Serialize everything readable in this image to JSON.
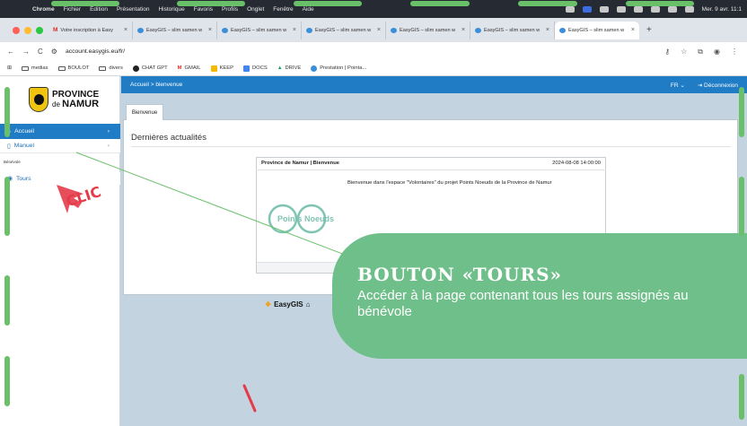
{
  "menubar": {
    "items": [
      "Chrome",
      "Fichier",
      "Édition",
      "Présentation",
      "Historique",
      "Favoris",
      "Profils",
      "Onglet",
      "Fenêtre",
      "Aide"
    ],
    "datetime": "Mer. 9 avr. 11:1"
  },
  "tabs": [
    {
      "label": "Votre inscription à Easy",
      "icon": "gmail-icon"
    },
    {
      "label": "EasyGIS – slim samen w",
      "icon": "easygis-icon"
    },
    {
      "label": "EasyGIS – slim samen w",
      "icon": "easygis-icon"
    },
    {
      "label": "EasyGIS – slim samen w",
      "icon": "easygis-icon"
    },
    {
      "label": "EasyGIS – slim samen w",
      "icon": "easygis-icon"
    },
    {
      "label": "EasyGIS – slim samen w",
      "icon": "easygis-icon"
    },
    {
      "label": "EasyGIS – slim samen w",
      "icon": "easygis-icon"
    }
  ],
  "address": {
    "url": "account.easygis.eu/fr/"
  },
  "bookmarks": [
    "medias",
    "BOULOT",
    "divers",
    "CHAT GPT",
    "GMAIL",
    "KEEP",
    "DOCS",
    "DRIVE",
    "Prestation | Pointa..."
  ],
  "logo": {
    "line1": "PROVINCE",
    "line2a": "de ",
    "line2b": "NAMUR"
  },
  "sidebar": {
    "accueil": "Accueil",
    "manuel": "Manuel",
    "section": "Bénévole",
    "tours": "Tours"
  },
  "topbar": {
    "breadcrumb": "Accueil > bienvenue",
    "lang": "FR",
    "logout": "Déconnexion"
  },
  "main": {
    "tab": "Bienvenue",
    "title": "Dernières actualités"
  },
  "news": {
    "title": "Province de Namur | Bienvenue",
    "date": "2024-08-08 14:00:00",
    "body": "Bienvenue dans l'espace \"Volontaires\" du projet Points Noeuds de la Province de Namur",
    "logo_text": "Points Noeuds"
  },
  "footer": {
    "brand": "EasyGIS"
  },
  "callout": {
    "title": "BOUTON «TOURS»",
    "desc": "Accéder à la page contenant tous les tours assignés au bénévole",
    "clic": "CLIC"
  },
  "colors": {
    "accent": "#1f7cc5",
    "callout": "#6fbf8a",
    "annotation": "#e53a4a",
    "frame": "#6abf69"
  }
}
